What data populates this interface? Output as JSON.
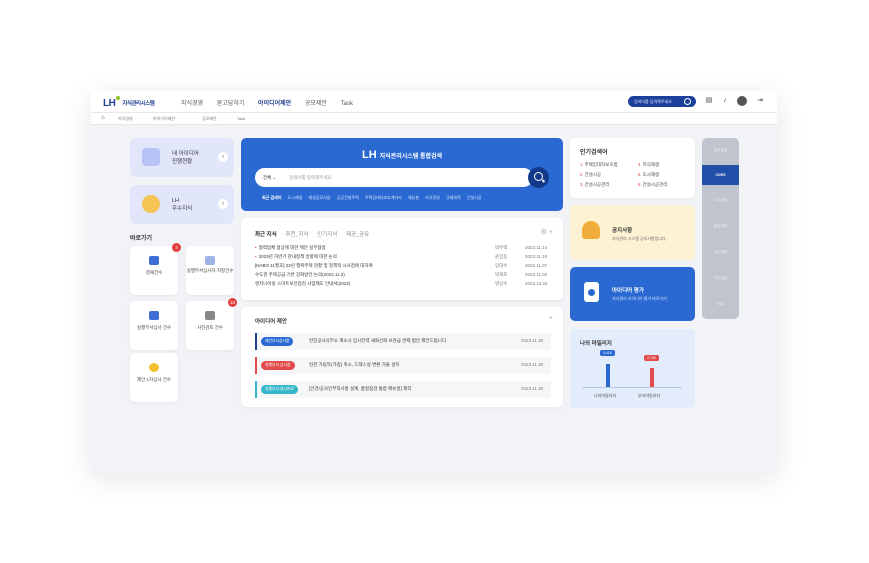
{
  "header": {
    "logo": "LH",
    "logo_text": "지식관리시스템",
    "menu": [
      "지식경영",
      "묻고답하기",
      "아이디어제안",
      "공모제안",
      "Task"
    ],
    "active_menu": "아이디어제안",
    "search_placeholder": "검색어를 입력해주세요"
  },
  "breadcrumb": [
    "지식경영",
    "아이디어제안",
    "공모제안",
    "Task"
  ],
  "left": {
    "cards": [
      {
        "label_1": "내 아이디어",
        "label_2": "진행현황"
      },
      {
        "label_1": "LH",
        "label_2": "우수지식"
      }
    ],
    "quick_title": "바로가기",
    "quick": [
      {
        "label": "결재건수",
        "badge": "3"
      },
      {
        "label": "실행부서심사자 지정건수",
        "badge": ""
      },
      {
        "label": "실행부서심사 건수",
        "badge": ""
      },
      {
        "label": "사전검토 건수",
        "badge": "10"
      },
      {
        "label": "제안 1차심사 건수",
        "badge": ""
      }
    ]
  },
  "search": {
    "title_logo": "LH",
    "title": "지식관리시스템 통합검색",
    "select": "전체",
    "placeholder": "검색어를 입력해주세요.",
    "recent_label": "최근 검색어",
    "keywords": [
      "도시재생",
      "재생공모사업",
      "공공건설주택",
      "주택임대차보호계약서",
      "재능봉",
      "지식경영",
      "규제개혁",
      "건설시공"
    ]
  },
  "news": {
    "tabs": [
      "최근 지식",
      "추천_지식",
      "인기지식",
      "제공_공유"
    ],
    "active_tab": "최근 지식",
    "rows": [
      {
        "title": "협력업체 협상에 대한 제안 실무협정",
        "author": "박주택",
        "date": "2023.11.14",
        "new": true
      },
      {
        "title": "2023년 하반기 관내정책 방향에 대한 논의",
        "author": "윤임동",
        "date": "2023.11.16",
        "new": true
      },
      {
        "title": "[NABO 11월호] 22년 행복주택 현황 및 정책적 시사점에 대하여",
        "author": "임대수",
        "date": "2023.11.07",
        "new": false
      },
      {
        "title": "수도권 주택공급 기반 강화방안 논의(2023.11.2)",
        "author": "박개포",
        "date": "2023.11.02",
        "new": false
      },
      {
        "title": "엔지니어링 스마트보안점검 사업제도 안내서(2022)",
        "author": "명상수",
        "date": "2023.10.22",
        "new": false
      }
    ]
  },
  "ideas": {
    "title": "아이디어 제안",
    "rows": [
      {
        "tag": "제안부서심사중",
        "title": "현장공사식부소 계소시 임시전력 새화선화 보관급 면제 법안 제안드립니다.",
        "date": "2023.11.30",
        "color": "#2a69d1"
      },
      {
        "tag": "실행부서 심사중",
        "title": "현관 가림막(가칭) 축소, 드레스실 변환 거울 설치",
        "date": "2023.11.30",
        "color": "#e34a4a"
      },
      {
        "tag": "실행부서 실시완료",
        "title": "[인건/공사인부직사항 설계, 품질점검 통합 매뉴얼] 제작",
        "date": "2023.11.30",
        "color": "#36b6c8"
      }
    ]
  },
  "popular": {
    "title": "인기검색어",
    "items": [
      "주택임대차보호법",
      "건설시공",
      "건설시공관리",
      "지식재생",
      "도시재생",
      "건설시공관리"
    ]
  },
  "notice": {
    "title": "공지사항",
    "sub": "지식관리 시스템 공지사항입니다."
  },
  "idea_eval": {
    "title": "아이디어 평가",
    "sub": "지식관리 아이디어 평가 바로가기"
  },
  "mileage": {
    "title": "나의 마일리지",
    "bars": [
      {
        "label": "나의마일리지",
        "value": "3,415",
        "level": 0.68,
        "color": "#2a69d1"
      },
      {
        "label": "부서마일리지",
        "value": "2,765",
        "level": 0.55,
        "color": "#e34a4a"
      }
    ]
  },
  "right_side": [
    "공지알림",
    "CDRS",
    "우수알람",
    "공지사항",
    "우수현황",
    "자주질문",
    "FAQ"
  ],
  "right_side_active": "CDRS"
}
